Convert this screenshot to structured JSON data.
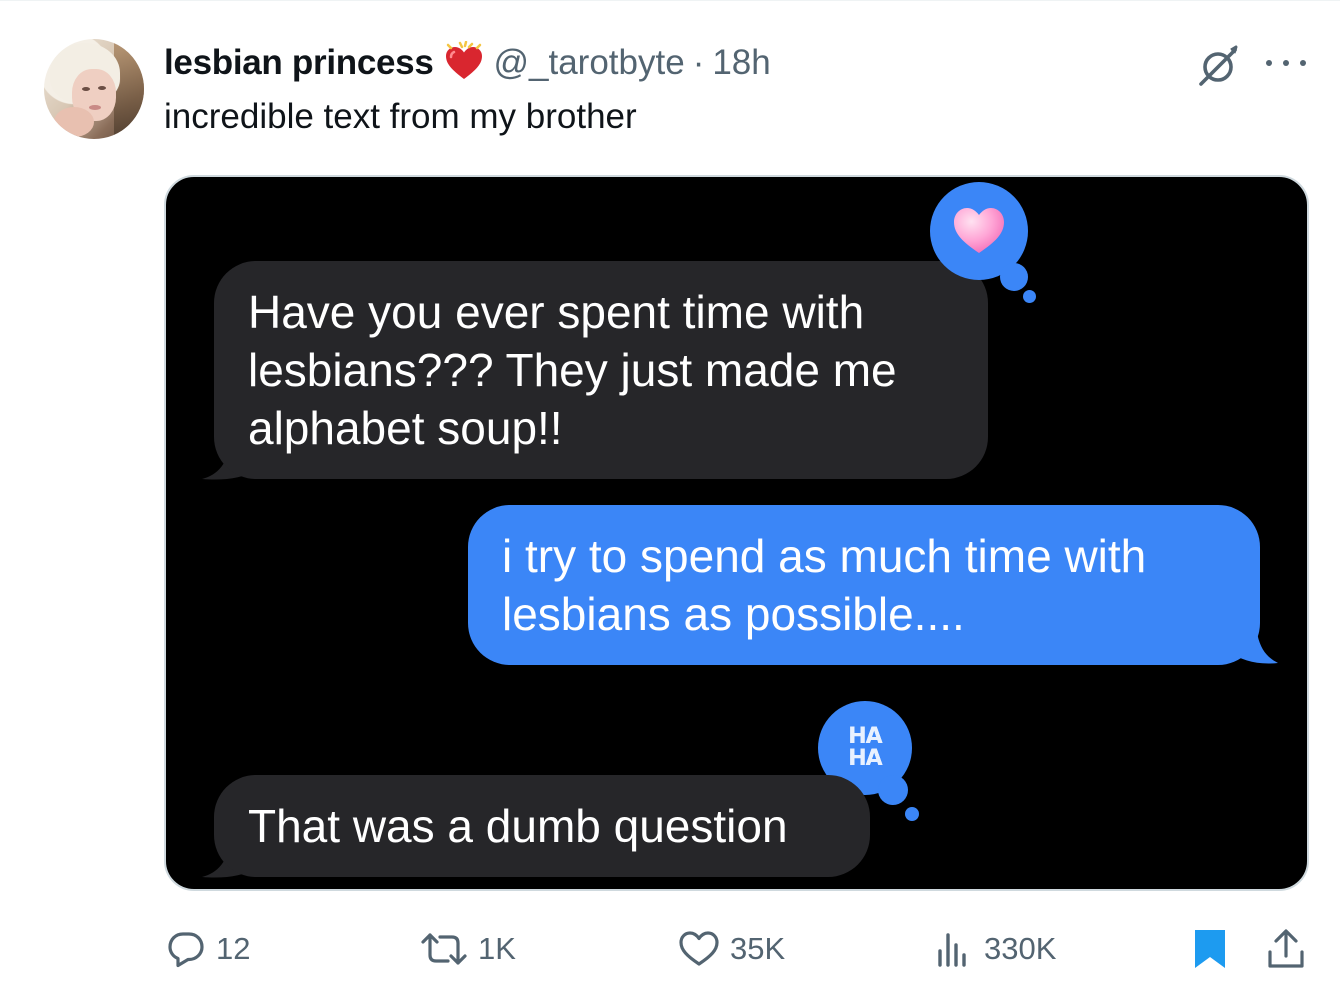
{
  "author": {
    "display_name": "lesbian princess",
    "handle": "@_tarotbyte",
    "separator": "·",
    "time": "18h"
  },
  "tweet": {
    "text": "incredible text from my brother"
  },
  "conversation": {
    "messages": [
      {
        "side": "received",
        "line1": "Have you ever spent time with",
        "line2": "lesbians??? They just made me",
        "line3": "alphabet soup!!"
      },
      {
        "side": "sent",
        "line1": "i try to spend as much time with",
        "line2": "lesbians as possible...."
      },
      {
        "side": "received",
        "line1": "That was a dumb question"
      }
    ],
    "reactions": [
      {
        "icon": "pink-heart-icon"
      },
      {
        "icon": "haha-icon",
        "line1": "HA",
        "line2": "HA"
      }
    ]
  },
  "actions": {
    "replies": "12",
    "reposts": "1K",
    "likes": "35K",
    "views": "330K"
  },
  "colors": {
    "sent_bubble": "#3b86f7",
    "received_bubble": "#262629",
    "bookmark_active": "#1d9bf0",
    "secondary_text": "#536471"
  }
}
